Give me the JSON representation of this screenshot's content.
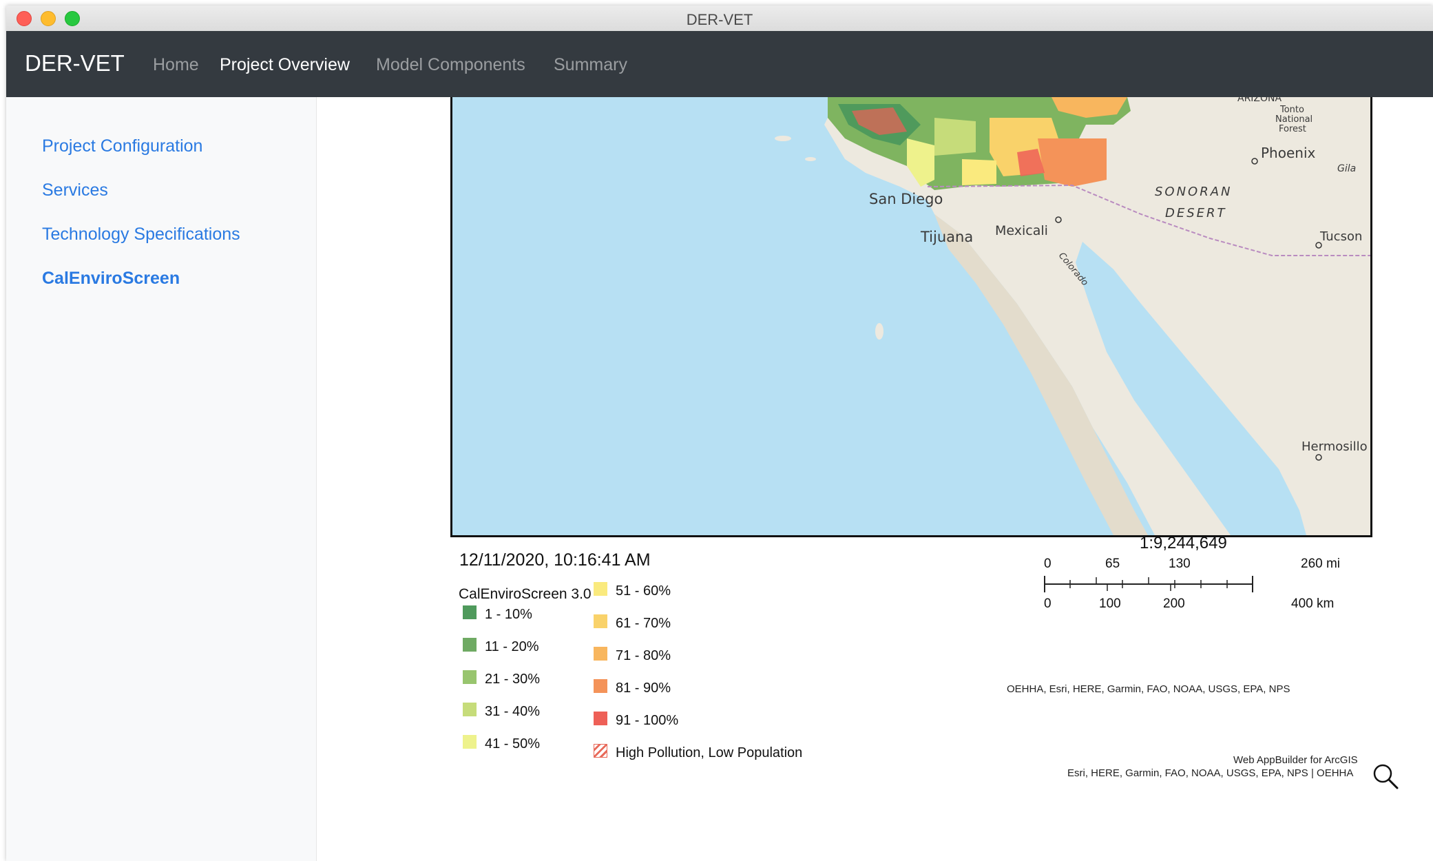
{
  "window": {
    "title": "DER-VET"
  },
  "navbar": {
    "brand": "DER-VET",
    "items": [
      {
        "label": "Home",
        "active": false
      },
      {
        "label": "Project Overview",
        "active": true
      },
      {
        "label": "Model Components",
        "active": false
      },
      {
        "label": "Summary",
        "active": false
      }
    ]
  },
  "sidebar": {
    "items": [
      {
        "label": "Project Configuration",
        "active": false
      },
      {
        "label": "Services",
        "active": false
      },
      {
        "label": "Technology Specifications",
        "active": false
      },
      {
        "label": "CalEnviroScreen",
        "active": true
      }
    ]
  },
  "map": {
    "places": {
      "arizona": "ARIZONA",
      "tonto1": "Tonto",
      "tonto2": "National",
      "tonto3": "Forest",
      "phoenix": "Phoenix",
      "gila": "Gila",
      "san_diego": "San Diego",
      "sonoran1": "SONORAN",
      "sonoran2": "DESERT",
      "tijuana": "Tijuana",
      "mexicali": "Mexicali",
      "colorado": "Colorado",
      "tucson": "Tucson",
      "hermosillo": "Hermosillo"
    },
    "timestamp": "12/11/2020, 10:16:41 AM",
    "scale": {
      "ratio": "1:9,244,649",
      "miles": [
        "0",
        "65",
        "130",
        "260 mi"
      ],
      "km": [
        "0",
        "100",
        "200",
        "400 km"
      ]
    },
    "attribution": "OEHHA, Esri, HERE, Garmin, FAO, NOAA, USGS, EPA, NPS",
    "credit_line1": "Web AppBuilder for ArcGIS",
    "credit_line2": "Esri, HERE, Garmin, FAO, NOAA, USGS, EPA, NPS | OEHHA"
  },
  "legend": {
    "title": "CalEnviroScreen 3.0",
    "items": [
      {
        "label": "1 - 10%",
        "color": "#4f9a5c"
      },
      {
        "label": "11 - 20%",
        "color": "#6faa63"
      },
      {
        "label": "21 - 30%",
        "color": "#98c56e"
      },
      {
        "label": "31 - 40%",
        "color": "#c6dc7a"
      },
      {
        "label": "41 - 50%",
        "color": "#eef28c"
      },
      {
        "label": "51 - 60%",
        "color": "#faea7e"
      },
      {
        "label": "61 - 70%",
        "color": "#f9d26a"
      },
      {
        "label": "71 - 80%",
        "color": "#f8b65e"
      },
      {
        "label": "81 - 90%",
        "color": "#f49359"
      },
      {
        "label": "91 - 100%",
        "color": "#ee6057"
      },
      {
        "label": "High Pollution, Low Population",
        "color": "#e86a5a"
      }
    ]
  },
  "colors": {
    "navbar": "#343a40",
    "link": "#2a7ae2",
    "ocean": "#b7e0f3",
    "land": "#ede9df"
  }
}
